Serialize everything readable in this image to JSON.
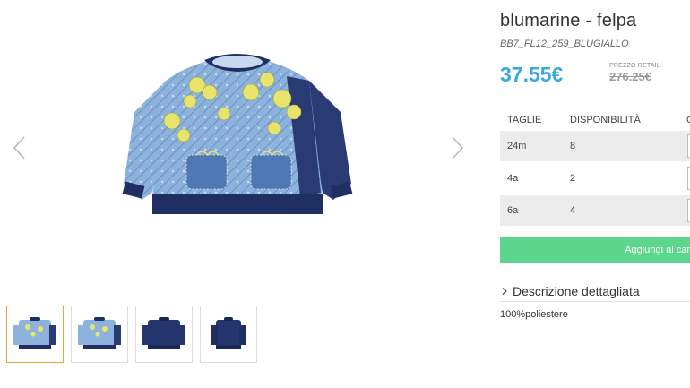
{
  "product": {
    "title": "blumarine - felpa",
    "sku": "BB7_FL12_259_BLUGIALLO",
    "price": "37.55€",
    "retail_label": "PREZZO RETAIL",
    "retail_price": "276.25€"
  },
  "sizes": {
    "headers": [
      "TAGLIE",
      "DISPONIBILITÀ",
      "Q"
    ],
    "rows": [
      {
        "size": "24m",
        "availability": "8"
      },
      {
        "size": "4a",
        "availability": "2"
      },
      {
        "size": "6a",
        "availability": "4"
      }
    ]
  },
  "actions": {
    "add_to_cart": "Aggiungi al car"
  },
  "description": {
    "toggle_label": "Descrizione dettagliata",
    "text": "100%poliestere"
  },
  "gallery": {
    "thumbnails": [
      {
        "view": "front-print",
        "active": true
      },
      {
        "view": "front-print",
        "active": false
      },
      {
        "view": "back-navy",
        "active": false
      },
      {
        "view": "side-navy",
        "active": false
      }
    ]
  },
  "colors": {
    "price": "#39a8dc",
    "cart_button": "#5dd68d",
    "active_thumb_border": "#f0a13a",
    "navy": "#1f2f63",
    "denim": "#8db3dd",
    "flower": "#e8e36a"
  },
  "icons": {
    "prev": "chevron-left-icon",
    "next": "chevron-right-icon",
    "expand": "chevron-right-icon"
  }
}
